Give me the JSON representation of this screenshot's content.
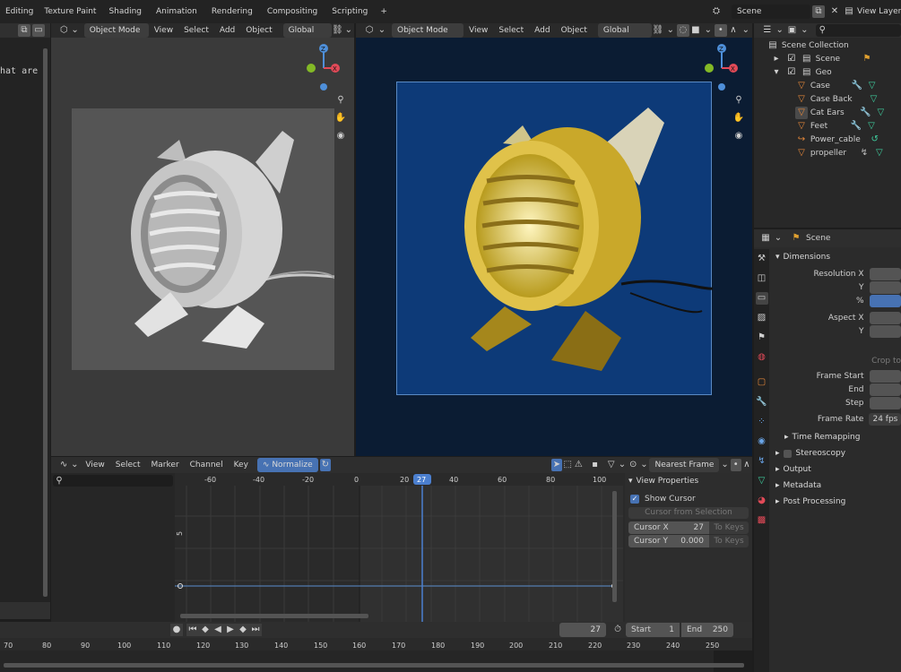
{
  "topbar": {
    "tabs": [
      "Editing",
      "Texture Paint",
      "Shading",
      "Animation",
      "Rendering",
      "Compositing",
      "Scripting"
    ],
    "add_tab": "+",
    "scene_name": "Scene",
    "view_layer": "View Layer"
  },
  "left_editor": {
    "text_fragment": "hat are"
  },
  "viewport_left": {
    "mode": "Object Mode",
    "menus": [
      "View",
      "Select",
      "Add",
      "Object"
    ],
    "transform": "Global",
    "gizmo": {
      "x": "X",
      "y": "Y",
      "z": "Z"
    }
  },
  "viewport_right": {
    "mode": "Object Mode",
    "menus": [
      "View",
      "Select",
      "Add",
      "Object"
    ],
    "transform": "Global",
    "gizmo": {
      "x": "X",
      "y": "Y",
      "z": "Z"
    }
  },
  "outliner": {
    "search_placeholder": "",
    "items": [
      {
        "label": "Scene Collection",
        "indent": 0
      },
      {
        "label": "Scene",
        "indent": 1
      },
      {
        "label": "Geo",
        "indent": 1
      },
      {
        "label": "Case",
        "indent": 2
      },
      {
        "label": "Case Back",
        "indent": 2
      },
      {
        "label": "Cat Ears",
        "indent": 2
      },
      {
        "label": "Feet",
        "indent": 2
      },
      {
        "label": "Power_cable",
        "indent": 2
      },
      {
        "label": "propeller",
        "indent": 2
      }
    ]
  },
  "properties": {
    "context": "Scene",
    "dimensions_label": "Dimensions",
    "resolution_x": "Resolution X",
    "y1": "Y",
    "percent": "%",
    "aspect_x": "Aspect X",
    "y2": "Y",
    "crop": "Crop to",
    "frame_start": "Frame Start",
    "end": "End",
    "step": "Step",
    "frame_rate": "Frame Rate",
    "frame_rate_value": "24 fps",
    "time_remapping": "Time Remapping",
    "stereoscopy": "Stereoscopy",
    "output": "Output",
    "metadata": "Metadata",
    "post_processing": "Post Processing"
  },
  "graph_editor": {
    "menus": [
      "View",
      "Select",
      "Marker",
      "Channel",
      "Key"
    ],
    "normalize": "Normalize",
    "interp": "Nearest Frame",
    "ruler": [
      "-60",
      "-40",
      "-20",
      "0",
      "20",
      "40",
      "60",
      "80",
      "100"
    ],
    "current_frame": "27",
    "y_tick": "5",
    "sidebar": {
      "title": "View Properties",
      "show_cursor": "Show Cursor",
      "cursor_from_selection": "Cursor from Selection",
      "cursor_x_label": "Cursor X",
      "cursor_x_value": "27",
      "cursor_y_label": "Cursor Y",
      "cursor_y_value": "0.000",
      "to_keys": "To Keys"
    }
  },
  "timeline": {
    "current_frame": "27",
    "start_label": "Start",
    "start_value": "1",
    "end_label": "End",
    "end_value": "250",
    "ruler": [
      "70",
      "80",
      "90",
      "100",
      "110",
      "120",
      "130",
      "140",
      "150",
      "160",
      "170",
      "180",
      "190",
      "200",
      "210",
      "220",
      "230",
      "240",
      "250"
    ]
  }
}
